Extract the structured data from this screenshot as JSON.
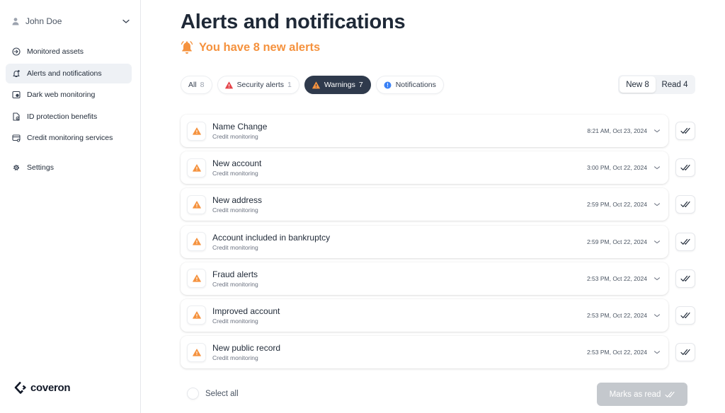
{
  "user": {
    "name": "John Doe"
  },
  "sidebar": {
    "items": [
      {
        "label": "Monitored assets",
        "icon": "monitor-arrow-icon"
      },
      {
        "label": "Alerts and notifications",
        "icon": "bell-icon",
        "active": true
      },
      {
        "label": "Dark web monitoring",
        "icon": "dark-web-icon"
      },
      {
        "label": "ID protection benefits",
        "icon": "id-protection-icon"
      },
      {
        "label": "Credit monitoring services",
        "icon": "credit-card-icon"
      }
    ],
    "settings_label": "Settings"
  },
  "brand": {
    "name": "coveron"
  },
  "page": {
    "title": "Alerts and notifications",
    "subtitle": "You have 8 new alerts"
  },
  "tabs": [
    {
      "label": "All",
      "count": "8"
    },
    {
      "label": "Security alerts",
      "count": "1",
      "icon": "red-warning-icon"
    },
    {
      "label": "Warnings",
      "count": "7",
      "icon": "orange-warning-icon",
      "active": true
    },
    {
      "label": "Notifications",
      "icon": "blue-info-icon"
    }
  ],
  "toggle": {
    "new_label": "New 8",
    "read_label": "Read 4"
  },
  "alerts": [
    {
      "title": "Name Change",
      "subtitle": "Credit monitoring",
      "time": "8:21 AM, Oct 23, 2024"
    },
    {
      "title": "New account",
      "subtitle": "Credit monitoring",
      "time": "3:00 PM, Oct 22, 2024"
    },
    {
      "title": "New address",
      "subtitle": "Credit monitoring",
      "time": "2:59 PM, Oct 22, 2024"
    },
    {
      "title": "Account included in bankruptcy",
      "subtitle": "Credit monitoring",
      "time": "2:59 PM, Oct 22, 2024"
    },
    {
      "title": "Fraud alerts",
      "subtitle": "Credit monitoring",
      "time": "2:53 PM, Oct 22, 2024"
    },
    {
      "title": "Improved account",
      "subtitle": "Credit monitoring",
      "time": "2:53 PM, Oct 22, 2024"
    },
    {
      "title": "New public record",
      "subtitle": "Credit monitoring",
      "time": "2:53 PM, Oct 22, 2024"
    }
  ],
  "footer": {
    "select_all_label": "Select all",
    "mark_read_label": "Marks as read"
  },
  "colors": {
    "accent_orange": "#f5923e",
    "active_tab": "#2f3a4c",
    "security_red": "#e5484d",
    "info_blue": "#3b82f6",
    "disabled_button": "#c4c8cd"
  }
}
